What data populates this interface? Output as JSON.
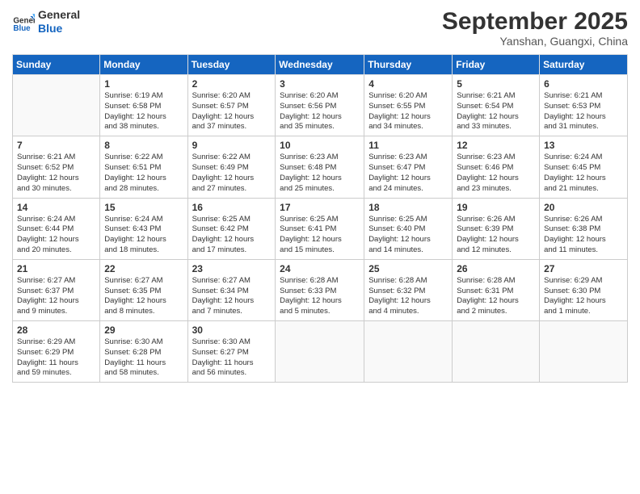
{
  "header": {
    "logo_general": "General",
    "logo_blue": "Blue",
    "month_title": "September 2025",
    "location": "Yanshan, Guangxi, China"
  },
  "days_of_week": [
    "Sunday",
    "Monday",
    "Tuesday",
    "Wednesday",
    "Thursday",
    "Friday",
    "Saturday"
  ],
  "weeks": [
    [
      {
        "num": "",
        "info": ""
      },
      {
        "num": "1",
        "info": "Sunrise: 6:19 AM\nSunset: 6:58 PM\nDaylight: 12 hours\nand 38 minutes."
      },
      {
        "num": "2",
        "info": "Sunrise: 6:20 AM\nSunset: 6:57 PM\nDaylight: 12 hours\nand 37 minutes."
      },
      {
        "num": "3",
        "info": "Sunrise: 6:20 AM\nSunset: 6:56 PM\nDaylight: 12 hours\nand 35 minutes."
      },
      {
        "num": "4",
        "info": "Sunrise: 6:20 AM\nSunset: 6:55 PM\nDaylight: 12 hours\nand 34 minutes."
      },
      {
        "num": "5",
        "info": "Sunrise: 6:21 AM\nSunset: 6:54 PM\nDaylight: 12 hours\nand 33 minutes."
      },
      {
        "num": "6",
        "info": "Sunrise: 6:21 AM\nSunset: 6:53 PM\nDaylight: 12 hours\nand 31 minutes."
      }
    ],
    [
      {
        "num": "7",
        "info": "Sunrise: 6:21 AM\nSunset: 6:52 PM\nDaylight: 12 hours\nand 30 minutes."
      },
      {
        "num": "8",
        "info": "Sunrise: 6:22 AM\nSunset: 6:51 PM\nDaylight: 12 hours\nand 28 minutes."
      },
      {
        "num": "9",
        "info": "Sunrise: 6:22 AM\nSunset: 6:49 PM\nDaylight: 12 hours\nand 27 minutes."
      },
      {
        "num": "10",
        "info": "Sunrise: 6:23 AM\nSunset: 6:48 PM\nDaylight: 12 hours\nand 25 minutes."
      },
      {
        "num": "11",
        "info": "Sunrise: 6:23 AM\nSunset: 6:47 PM\nDaylight: 12 hours\nand 24 minutes."
      },
      {
        "num": "12",
        "info": "Sunrise: 6:23 AM\nSunset: 6:46 PM\nDaylight: 12 hours\nand 23 minutes."
      },
      {
        "num": "13",
        "info": "Sunrise: 6:24 AM\nSunset: 6:45 PM\nDaylight: 12 hours\nand 21 minutes."
      }
    ],
    [
      {
        "num": "14",
        "info": "Sunrise: 6:24 AM\nSunset: 6:44 PM\nDaylight: 12 hours\nand 20 minutes."
      },
      {
        "num": "15",
        "info": "Sunrise: 6:24 AM\nSunset: 6:43 PM\nDaylight: 12 hours\nand 18 minutes."
      },
      {
        "num": "16",
        "info": "Sunrise: 6:25 AM\nSunset: 6:42 PM\nDaylight: 12 hours\nand 17 minutes."
      },
      {
        "num": "17",
        "info": "Sunrise: 6:25 AM\nSunset: 6:41 PM\nDaylight: 12 hours\nand 15 minutes."
      },
      {
        "num": "18",
        "info": "Sunrise: 6:25 AM\nSunset: 6:40 PM\nDaylight: 12 hours\nand 14 minutes."
      },
      {
        "num": "19",
        "info": "Sunrise: 6:26 AM\nSunset: 6:39 PM\nDaylight: 12 hours\nand 12 minutes."
      },
      {
        "num": "20",
        "info": "Sunrise: 6:26 AM\nSunset: 6:38 PM\nDaylight: 12 hours\nand 11 minutes."
      }
    ],
    [
      {
        "num": "21",
        "info": "Sunrise: 6:27 AM\nSunset: 6:37 PM\nDaylight: 12 hours\nand 9 minutes."
      },
      {
        "num": "22",
        "info": "Sunrise: 6:27 AM\nSunset: 6:35 PM\nDaylight: 12 hours\nand 8 minutes."
      },
      {
        "num": "23",
        "info": "Sunrise: 6:27 AM\nSunset: 6:34 PM\nDaylight: 12 hours\nand 7 minutes."
      },
      {
        "num": "24",
        "info": "Sunrise: 6:28 AM\nSunset: 6:33 PM\nDaylight: 12 hours\nand 5 minutes."
      },
      {
        "num": "25",
        "info": "Sunrise: 6:28 AM\nSunset: 6:32 PM\nDaylight: 12 hours\nand 4 minutes."
      },
      {
        "num": "26",
        "info": "Sunrise: 6:28 AM\nSunset: 6:31 PM\nDaylight: 12 hours\nand 2 minutes."
      },
      {
        "num": "27",
        "info": "Sunrise: 6:29 AM\nSunset: 6:30 PM\nDaylight: 12 hours\nand 1 minute."
      }
    ],
    [
      {
        "num": "28",
        "info": "Sunrise: 6:29 AM\nSunset: 6:29 PM\nDaylight: 11 hours\nand 59 minutes."
      },
      {
        "num": "29",
        "info": "Sunrise: 6:30 AM\nSunset: 6:28 PM\nDaylight: 11 hours\nand 58 minutes."
      },
      {
        "num": "30",
        "info": "Sunrise: 6:30 AM\nSunset: 6:27 PM\nDaylight: 11 hours\nand 56 minutes."
      },
      {
        "num": "",
        "info": ""
      },
      {
        "num": "",
        "info": ""
      },
      {
        "num": "",
        "info": ""
      },
      {
        "num": "",
        "info": ""
      }
    ]
  ]
}
